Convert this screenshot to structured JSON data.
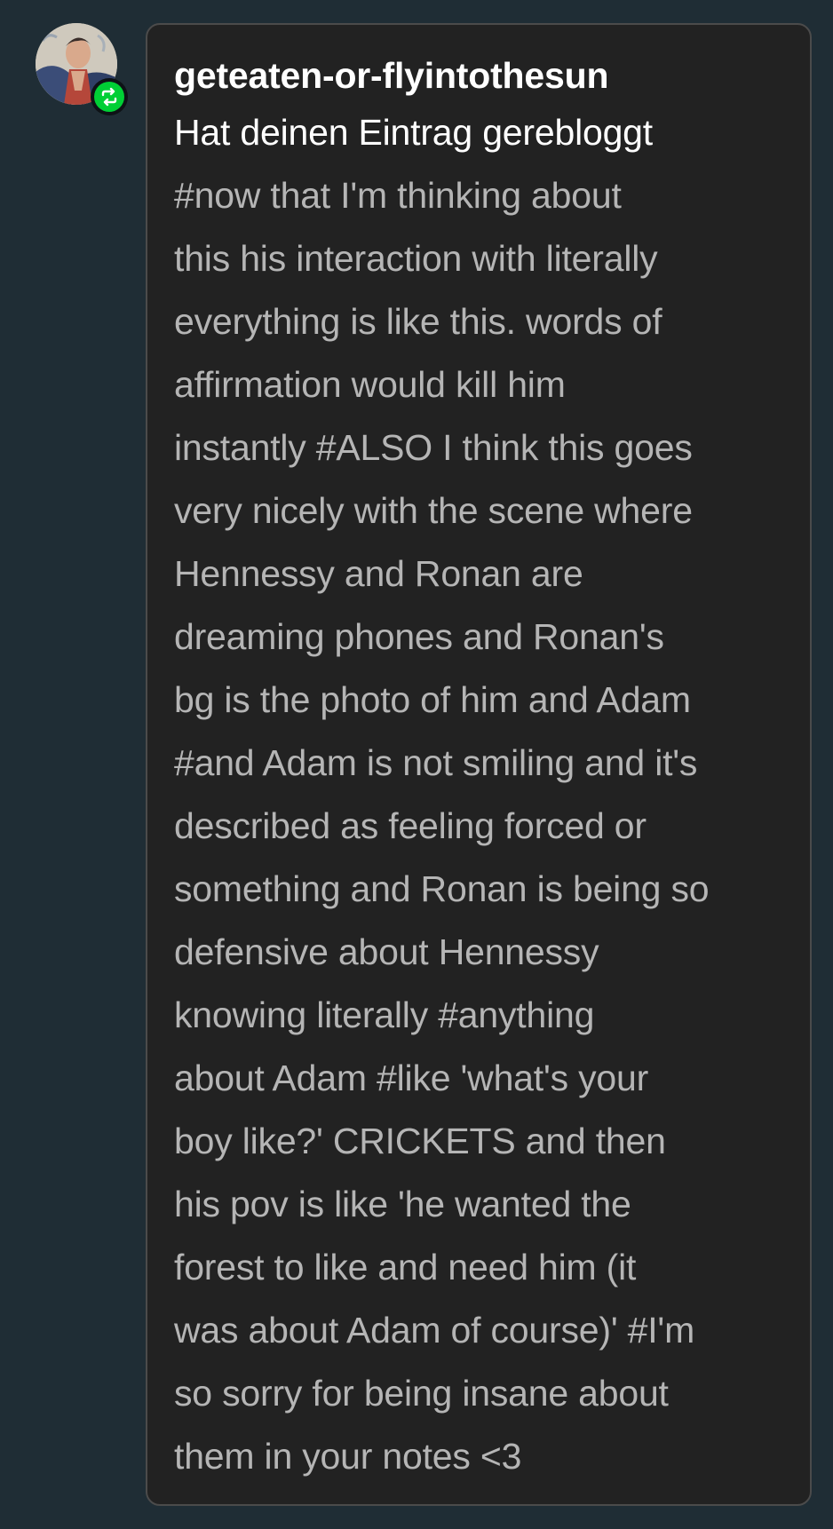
{
  "post": {
    "username": "geteaten-or-flyintothesun",
    "action": "Hat deinen Eintrag gerebloggt",
    "tag_lines": [
      "#now that I'm thinking about",
      "this his interaction with literally",
      "everything is like this. words of",
      "affirmation would kill him",
      "instantly #ALSO I think this goes",
      "very nicely with the scene where",
      "Hennessy and Ronan are",
      "dreaming phones and Ronan's",
      "bg is the photo of him and Adam",
      "#and Adam is not smiling and it's",
      "described as feeling forced or",
      "something and Ronan is being so",
      "defensive about Hennessy",
      "knowing literally #anything",
      "about Adam #like 'what's your",
      "boy like?' CRICKETS and then",
      "his pov is like 'he wanted the",
      "forest to like and need him (it",
      "was about Adam of course)' #I'm",
      "so sorry for being insane about",
      "them in your notes <3"
    ]
  },
  "icons": {
    "avatar": "avatar-icon",
    "reblog_badge": "reblog-icon"
  },
  "colors": {
    "background": "#1f2d35",
    "card": "#222222",
    "card_border": "#4b4b4b",
    "username_text": "#ffffff",
    "tag_text": "#b5b5b5",
    "reblog_green": "#00cf35"
  }
}
